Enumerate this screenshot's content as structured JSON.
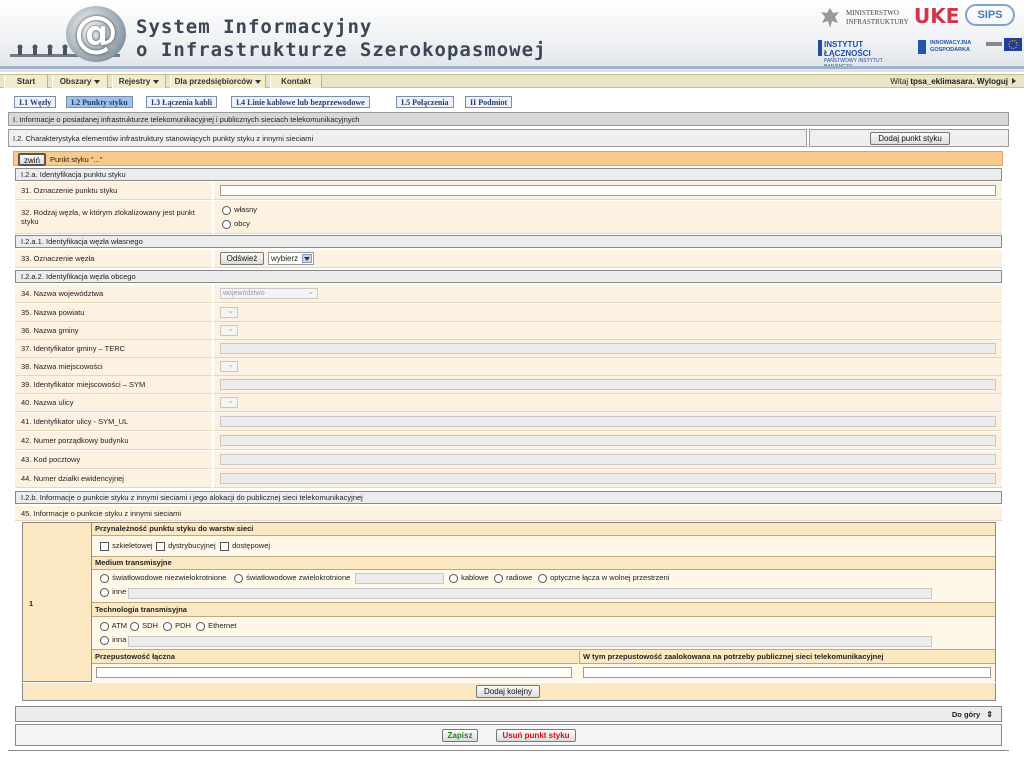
{
  "header": {
    "title_line1": "System Informacyjny",
    "title_line2": "o Infrastrukturze Szerokopasmowej",
    "logo_at": "@",
    "partners": {
      "ministry": "MINISTERSTWO\nINFRASTRUKTURY",
      "uke": "UKE",
      "sips": "SIPS",
      "il": "INSTYTUT ŁĄCZNOŚCI",
      "il_sub": "PAŃSTWOWY INSTYTUT BADAWCZY",
      "ig": "INNOWACYJNA GOSPODARKA"
    }
  },
  "nav": {
    "items": [
      "Start",
      "Obszary",
      "Rejestry",
      "Dla przedsiębiorców",
      "Kontakt"
    ],
    "welcome": "Witaj",
    "user": "tpsa_eklimasara",
    "logout": ". Wyloguj"
  },
  "tabs": [
    "I.1 Węzły",
    "I.2 Punkty styku",
    "I.3 Łączenia kabli",
    "I.4 Linie kablowe lub bezprzewodowe",
    "I.5 Połączenia",
    "II Podmiot"
  ],
  "section1": "I. Informacje o posiadanej infrastrukturze telekomunikacyjnej i publicznych sieciach telekomunikacyjnych",
  "section2": "I.2. Charakterystyka elementów infrastruktury stanowiących punkty styku z innymi sieciami",
  "add_point_button": "Dodaj punkt styku",
  "collapse_button": "zwiń",
  "point_title": "Punkt styku \"...\"",
  "sub_a": "I.2.a. Identyfikacja punktu styku",
  "f31": "31. Oznaczenie punktu styku",
  "f32": "32. Rodzaj węzła, w którym zlokalizowany jest punkt styku",
  "f32_opt1": "własny",
  "f32_opt2": "obcy",
  "sub_a1": "I.2.a.1. Identyfikacja węzła własnego",
  "f33": "33. Oznaczenie węzła",
  "refresh_button": "Odśwież",
  "select_placeholder": "wybierz",
  "sub_a2": "I.2.a.2. Identyfikacja węzła obcego",
  "fields": [
    "34. Nazwa województwa",
    "35. Nazwa powiatu",
    "36. Nazwa gminy",
    "37. Identyfikator gminy – TERC",
    "38. Nazwa miejscowości",
    "39. Identyfikator miejscowości – SYM",
    "40. Nazwa ulicy",
    "41. Identyfikator ulicy - SYM_UL",
    "42. Numer porządkowy budynku",
    "43. Kod pocztowy",
    "44. Numer działki ewidencyjnej"
  ],
  "voivodeship_select": "województwo",
  "sub_b": "I.2.b. Informacje o punkcie styku z innymi sieciami i jego alokacji do publicznej sieci telekomunikacyjnej",
  "f45": "45. Informacje o punkcie styku z innymi sieciami",
  "row_number": "1",
  "layers": {
    "header": "Przynależność punktu styku do warstw sieci",
    "options": [
      "szkieletowej",
      "dystrybucyjnej",
      "dostępowej"
    ]
  },
  "medium": {
    "header": "Medium transmisyjne",
    "options": [
      "światłowodowe niezwielokrotnione",
      "światłowodowe zwielokrotnione",
      "kablowe",
      "radiowe",
      "optyczne łącza w wolnej przestrzeni"
    ],
    "other": "inne"
  },
  "technology": {
    "header": "Technologia transmisyjna",
    "options": [
      "ATM",
      "SDH",
      "PDH",
      "Ethernet"
    ],
    "other": "inna"
  },
  "capacity": "Przepustowość łączna",
  "capacity_public": "W tym przepustowość zaalokowana na potrzeby publicznej sieci telekomunikacyjnej",
  "add_next_button": "Dodaj kolejny",
  "top_link": "Do góry",
  "save_button": "Zapisz",
  "delete_button": "Usuń punkt styku",
  "colors": {
    "accent_tab": "#9ec4ea",
    "orange_bar": "#f7c98a",
    "save_green": "#1a8a1a",
    "delete_red": "#cc1111"
  }
}
